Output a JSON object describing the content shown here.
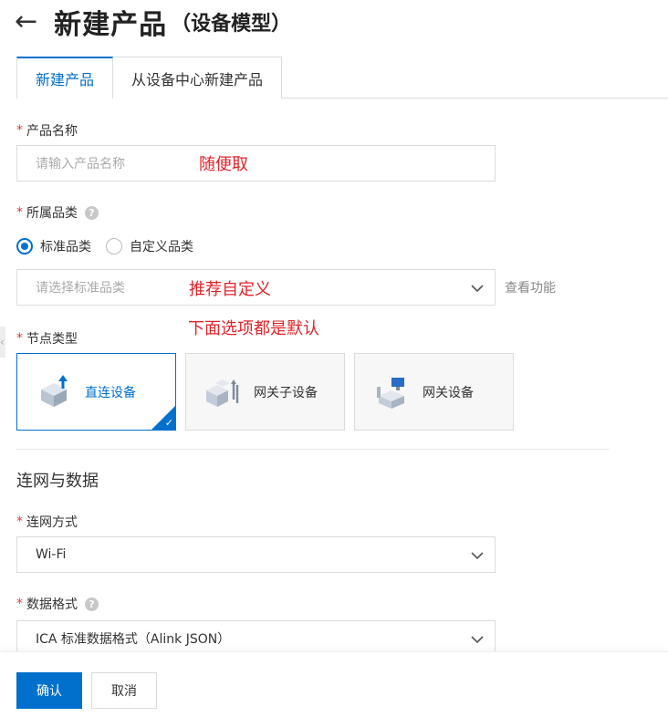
{
  "header": {
    "back_icon": "arrow-left-icon",
    "title": "新建产品",
    "subtitle": "（设备模型）"
  },
  "tabs": [
    {
      "label": "新建产品",
      "active": true
    },
    {
      "label": "从设备中心新建产品",
      "active": false
    }
  ],
  "product_name": {
    "label": "产品名称",
    "placeholder": "请输入产品名称",
    "annotation": "随便取"
  },
  "category": {
    "label": "所属品类",
    "radios": [
      {
        "label": "标准品类",
        "checked": true
      },
      {
        "label": "自定义品类",
        "checked": false
      }
    ],
    "select_placeholder": "请选择标准品类",
    "annotation": "推荐自定义",
    "view_link": "查看功能"
  },
  "node_type": {
    "label": "节点类型",
    "annotation": "下面选项都是默认",
    "options": [
      {
        "label": "直连设备",
        "icon": "direct-device-icon",
        "selected": true
      },
      {
        "label": "网关子设备",
        "icon": "gateway-subdevice-icon",
        "selected": false
      },
      {
        "label": "网关设备",
        "icon": "gateway-device-icon",
        "selected": false
      }
    ]
  },
  "network_section": {
    "title": "连网与数据"
  },
  "network_method": {
    "label": "连网方式",
    "value": "Wi-Fi"
  },
  "data_format": {
    "label": "数据格式",
    "value": "ICA 标准数据格式（Alink JSON）"
  },
  "footer": {
    "confirm_label": "确认",
    "cancel_label": "取消"
  },
  "colors": {
    "primary": "#0070cc",
    "required": "#e03c3c",
    "annotation": "#e0242a"
  }
}
